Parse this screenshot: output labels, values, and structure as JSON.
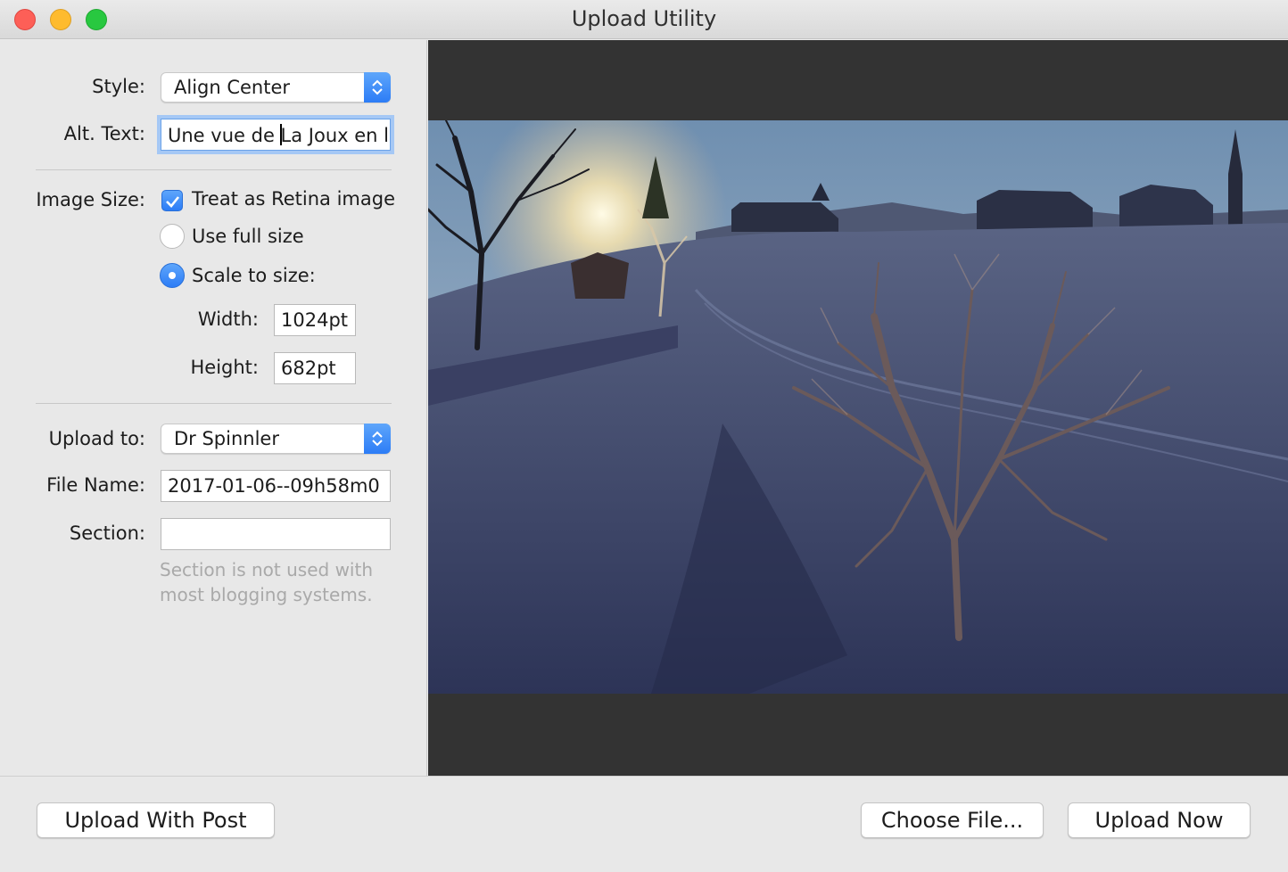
{
  "window": {
    "title": "Upload Utility"
  },
  "form": {
    "style_label": "Style:",
    "style_value": "Align Center",
    "alt_label": "Alt. Text:",
    "alt_before_caret": "Une vue de ",
    "alt_after_caret": "La Joux en l",
    "image_size_label": "Image Size:",
    "retina_label": "Treat as Retina image",
    "retina_checked": true,
    "full_size_label": "Use full size",
    "scale_label": "Scale to size:",
    "width_label": "Width:",
    "width_value": "1024pt",
    "height_label": "Height:",
    "height_value": "682pt",
    "upload_to_label": "Upload to:",
    "upload_to_value": "Dr Spinnler",
    "file_name_label": "File Name:",
    "file_name_value": "2017-01-06--09h58m0",
    "section_label": "Section:",
    "section_value": "",
    "section_hint": "Section is not used with most blogging systems."
  },
  "buttons": {
    "upload_with_post": "Upload With Post",
    "choose_file": "Choose File...",
    "upload_now": "Upload Now"
  },
  "colors": {
    "accent": "#2c7cf6",
    "preview_bg": "#333333"
  }
}
